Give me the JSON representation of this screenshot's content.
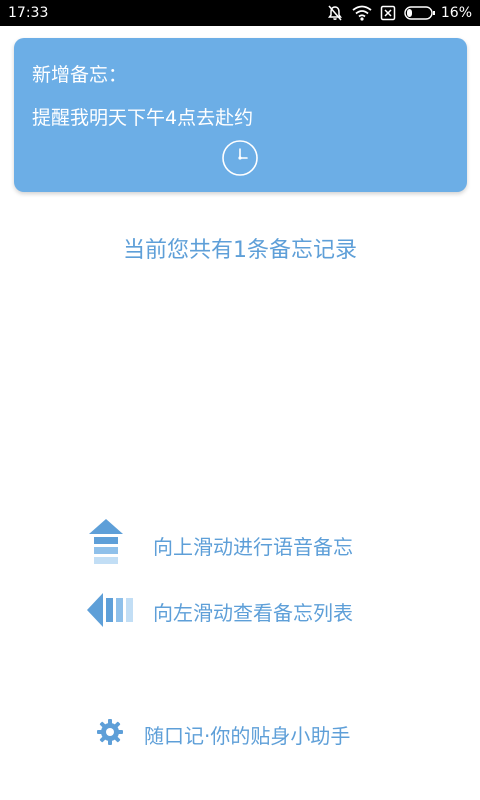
{
  "status_bar": {
    "time": "17:33",
    "battery": "16%",
    "icons": [
      "alarm-off-icon",
      "wifi-icon",
      "sim-x-icon",
      "battery-icon"
    ]
  },
  "memo_card": {
    "title": "新增备忘：",
    "text": "提醒我明天下午4点去赴约",
    "icon": "clock-icon",
    "background": "#6caee6"
  },
  "record_count": "当前您共有1条备忘记录",
  "hints": {
    "swipe_up": {
      "label": "向上滑动进行语音备忘",
      "icon": "arrow-up-icon"
    },
    "swipe_left": {
      "label": "向左滑动查看备忘列表",
      "icon": "arrow-left-icon"
    }
  },
  "footer": {
    "slogan": "随口记·你的贴身小助手",
    "icon": "gear-icon"
  },
  "colors": {
    "accent": "#5e9fd8",
    "card": "#6caee6",
    "status_bar": "#000000"
  }
}
